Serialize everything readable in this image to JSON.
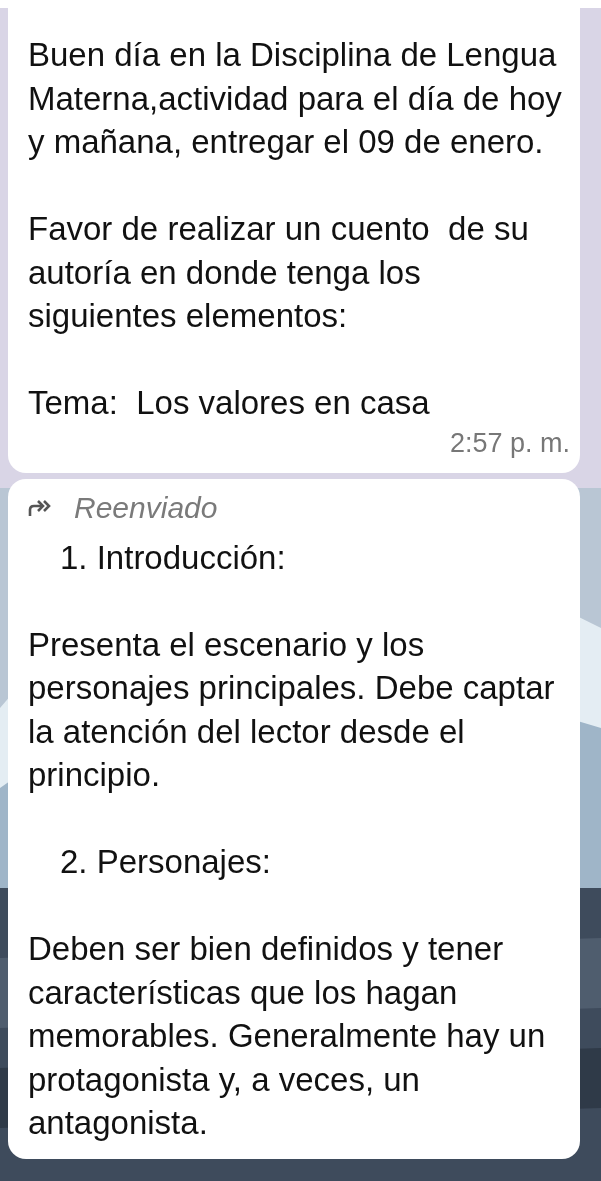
{
  "messages": [
    {
      "forwarded": false,
      "paragraphs": [
        {
          "text": "Buen día en la Disciplina de Lengua Materna,actividad para el día de hoy y mañana, entregar el 09 de enero.",
          "indented": false
        },
        {
          "text": "Favor de realizar un cuento  de su autoría en donde tenga los siguientes elementos:",
          "indented": false
        },
        {
          "text": "Tema:  Los valores en casa",
          "indented": false
        }
      ],
      "time": "2:57 p. m."
    },
    {
      "forwarded": true,
      "forwarded_label": "Reenviado",
      "paragraphs": [
        {
          "text": "1. Introducción:",
          "indented": true
        },
        {
          "text": "Presenta el escenario y los personajes principales. Debe captar la atención del lector desde el principio.",
          "indented": false
        },
        {
          "text": "2. Personajes:",
          "indented": true
        },
        {
          "text": "Deben ser bien definidos y tener características que los hagan memorables. Generalmente hay un protagonista y, a veces, un antagonista.",
          "indented": false
        }
      ]
    }
  ]
}
